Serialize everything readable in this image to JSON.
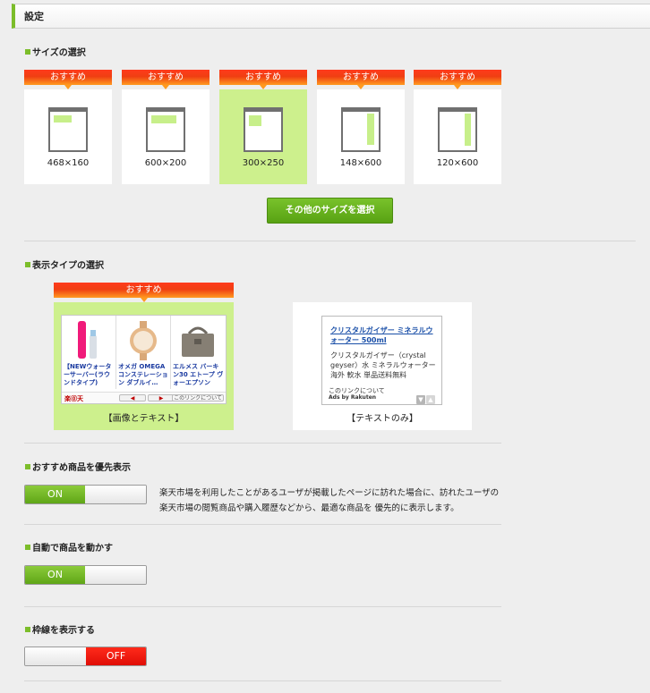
{
  "header": {
    "title": "設定"
  },
  "size_section": {
    "title": "サイズの選択",
    "recommend_label": "おすすめ",
    "options": [
      {
        "label": "468×160",
        "selected": false
      },
      {
        "label": "600×200",
        "selected": false
      },
      {
        "label": "300×250",
        "selected": true
      },
      {
        "label": "148×600",
        "selected": false
      },
      {
        "label": "120×600",
        "selected": false
      }
    ],
    "more_button": "その他のサイズを選択"
  },
  "display_section": {
    "title": "表示タイプの選択",
    "recommend_label": "おすすめ",
    "image_text": {
      "label": "【画像とテキスト】",
      "items": [
        "【NEWウォーターサーバー(ラウンドタイプ)",
        "オメガ OMEGA コンステレーション ダブルイ…",
        "エルメス バーキン30 エトープ ヴォーエプソン"
      ],
      "logo": "楽⓪天",
      "about_link": "このリンクについて"
    },
    "text_only": {
      "label": "【テキストのみ】",
      "ad_title": "クリスタルガイザー ミネラルウォーター 500ml",
      "ad_desc": "クリスタルガイザー（crystal geyser）水 ミネラルウォーター 海外 軟水 単品送料無料",
      "about_link": "このリンクについて",
      "ads_by": "Ads by Rakuten"
    }
  },
  "priority_section": {
    "title": "おすすめ商品を優先表示",
    "toggle": "ON",
    "description": "楽天市場を利用したことがあるユーザが掲載したページに訪れた場合に、訪れたユーザの楽天市場の閲覧商品や購入履歴などから、最適な商品を 優先的に表示します。"
  },
  "motion_section": {
    "title": "自動で商品を動かす",
    "toggle": "ON"
  },
  "border_section": {
    "title": "枠線を表示する",
    "toggle": "OFF"
  },
  "colors": {
    "accent": "#7cbd2a",
    "selected_bg": "#cdf08d",
    "recommend": "#f03f12",
    "off_red": "#e00e07"
  }
}
